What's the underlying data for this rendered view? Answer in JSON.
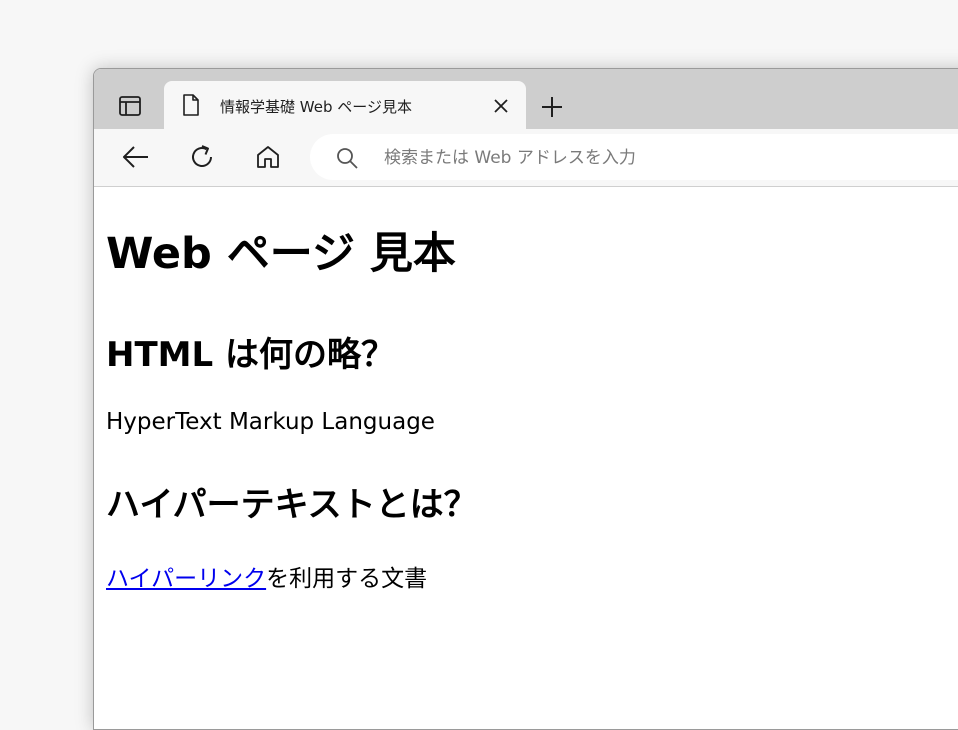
{
  "browser": {
    "tab": {
      "title": "情報学基礎 Web ページ見本"
    },
    "address_bar": {
      "placeholder": "検索または Web アドレスを入力",
      "value": ""
    },
    "icons": {
      "tab_actions": "tab-actions-icon",
      "page": "page-icon",
      "close": "close-icon",
      "new_tab": "plus-icon",
      "back": "back-arrow-icon",
      "refresh": "refresh-icon",
      "home": "home-icon",
      "search": "search-icon"
    }
  },
  "page": {
    "heading": "Web ページ 見本",
    "sections": [
      {
        "heading": "HTML は何の略？",
        "text": "HyperText Markup Language"
      },
      {
        "heading": "ハイパーテキストとは？",
        "link_text": "ハイパーリンク",
        "text_after_link": "を利用する文書"
      }
    ]
  },
  "colors": {
    "tabstrip": "#cecece",
    "toolbar": "#f7f7f7",
    "link": "#0000ee"
  }
}
